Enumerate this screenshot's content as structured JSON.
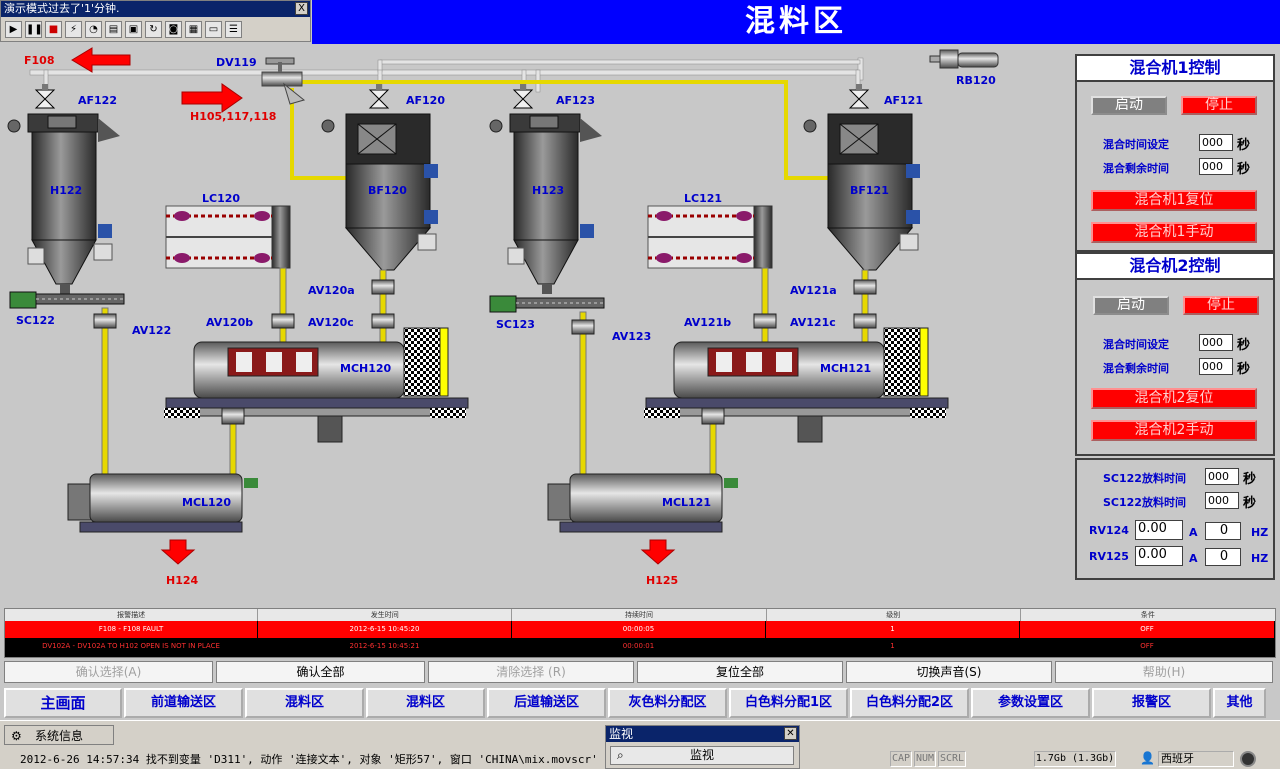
{
  "demo_window": {
    "title": "演示模式过去了'1'分钟.",
    "close": "X",
    "tools": [
      "play-icon",
      "pause-icon",
      "stop-icon",
      "lightning-icon",
      "chart-icon",
      "monitor-icon",
      "save-icon",
      "refresh-icon",
      "camera-icon",
      "image-icon",
      "window-icon",
      "list-icon"
    ]
  },
  "screen_title": "混料区",
  "plant_labels": {
    "f108": "F108",
    "h105": "H105,117,118",
    "dv119": "DV119",
    "rb120": "RB120",
    "af122": "AF122",
    "af120": "AF120",
    "af123": "AF123",
    "af121": "AF121",
    "h122": "H122",
    "bf120": "BF120",
    "h123": "H123",
    "bf121": "BF121",
    "lc120": "LC120",
    "lc121": "LC121",
    "sc122": "SC122",
    "sc123": "SC123",
    "av122": "AV122",
    "av123": "AV123",
    "av120a": "AV120a",
    "av120b": "AV120b",
    "av120c": "AV120c",
    "av121a": "AV121a",
    "av121b": "AV121b",
    "av121c": "AV121c",
    "mch120": "MCH120",
    "mch121": "MCH121",
    "mcl120": "MCL120",
    "mcl121": "MCL121",
    "h124": "H124",
    "h125": "H125"
  },
  "mixer1": {
    "title": "混合机1控制",
    "start": "启动",
    "stop": "停止",
    "set_time_label": "混合时间设定",
    "set_time_value": "000",
    "remain_label": "混合剩余时间",
    "remain_value": "000",
    "unit": "秒",
    "reset": "混合机1复位",
    "manual": "混合机1手动"
  },
  "mixer2": {
    "title": "混合机2控制",
    "start": "启动",
    "stop": "停止",
    "set_time_label": "混合时间设定",
    "set_time_value": "000",
    "remain_label": "混合剩余时间",
    "remain_value": "000",
    "unit": "秒",
    "reset": "混合机2复位",
    "manual": "混合机2手动"
  },
  "discharge": {
    "row1_label": "SC122放料时间",
    "row1_value": "000",
    "row2_label": "SC122放料时间",
    "row2_value": "000",
    "unit": "秒",
    "rv124_label": "RV124",
    "rv124_current": "0.00",
    "rv124_freq": "0",
    "rv125_label": "RV125",
    "rv125_current": "0.00",
    "rv125_freq": "0",
    "amp_unit": "A",
    "hz_unit": "HZ"
  },
  "alarm": {
    "headers": [
      "报警描述",
      "发生时间",
      "持续时间",
      "级别",
      "条件"
    ],
    "rows": [
      {
        "desc": "F108 - F108 FAULT",
        "time": "2012-6-15 10:45:20",
        "duration": "00:00:05",
        "level": "1",
        "cond": "OFF",
        "color": "#ff0000"
      },
      {
        "desc": "DV102A - DV102A TO H102 OPEN IS NOT IN PLACE",
        "time": "2012-6-15 10:45:21",
        "duration": "00:00:01",
        "level": "1",
        "cond": "OFF",
        "color": "#000000"
      }
    ]
  },
  "alarm_buttons": {
    "confirm_selected": "确认选择(A)",
    "confirm_all": "确认全部",
    "clear_selected": "清除选择 (R)",
    "reset_all": "复位全部",
    "toggle_sound": "切换声音(S)",
    "help": "帮助(H)"
  },
  "nav": [
    "主画面",
    "前道输送区",
    "混料区",
    "混料区",
    "后道输送区",
    "灰色料分配区",
    "白色料分配1区",
    "白色料分配2区",
    "参数设置区",
    "报警区",
    "其他"
  ],
  "status": {
    "sys_tab": "系统信息",
    "message": "2012-6-26 14:57:34 找不到变量 'D311', 动作 '连接文本', 对象 '矩形57', 窗口 'CHINA\\mix.movscr'",
    "monitor_title": "监视",
    "monitor_button": "监视",
    "cap": "CAP",
    "num": "NUM",
    "scrl": "SCRL",
    "memory": "1.7Gb (1.3Gb)",
    "user": "西班牙"
  }
}
